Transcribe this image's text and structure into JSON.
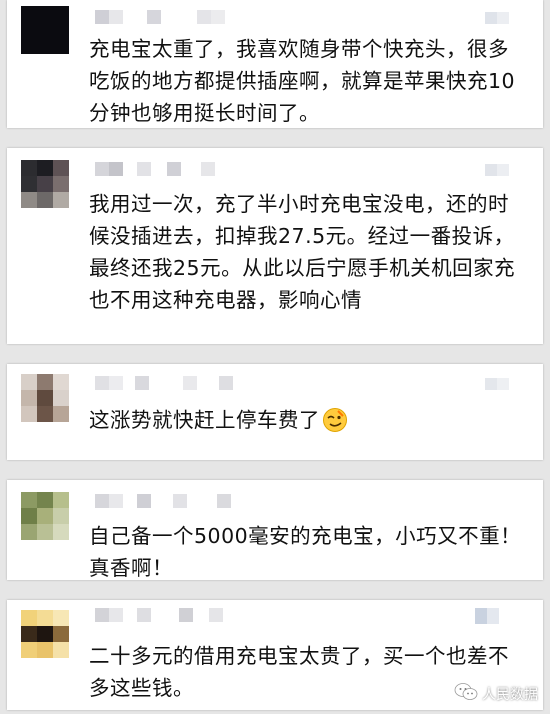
{
  "comments": [
    {
      "text": "充电宝太重了，我喜欢随身带个快充头，很多吃饭的地方都提供插座啊，就算是苹果快充10分钟也够用挺长时间了。"
    },
    {
      "text": "我用过一次，充了半小时充电宝没电，还的时候没插进去，扣掉我27.5元。经过一番投诉，最终还我25元。从此以后宁愿手机关机回家充也不用这种充电器，影响心情"
    },
    {
      "text": "这涨势就快赶上停车费了",
      "emoji": "face-emoji"
    },
    {
      "text": "自己备一个5000毫安的充电宝，小巧又不重！真香啊！"
    },
    {
      "text": "二十多元的借用充电宝太贵了，买一个也差不多这些钱。"
    }
  ],
  "watermark": {
    "label": "人民数据",
    "icon": "wechat-icon"
  }
}
